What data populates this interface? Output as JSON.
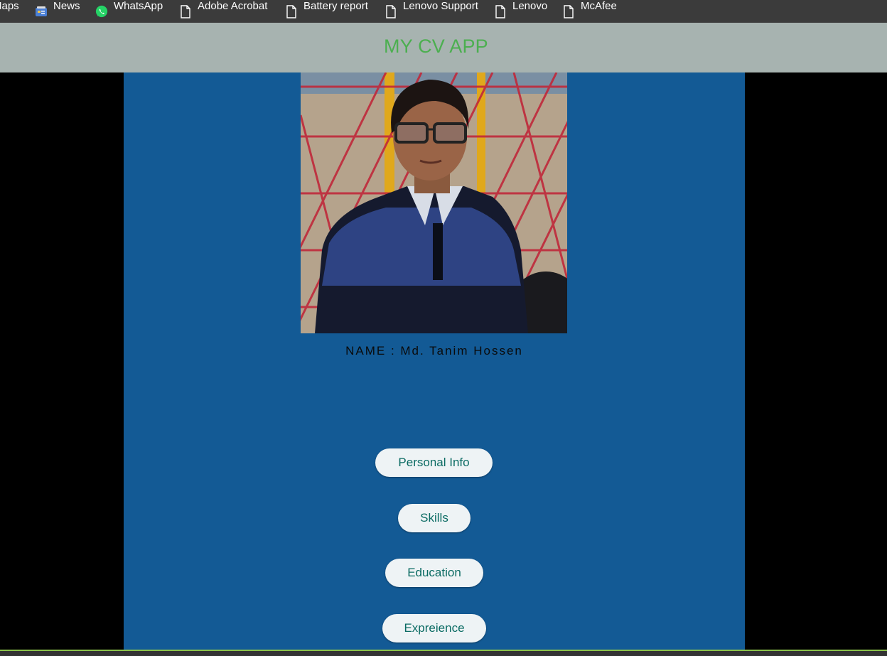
{
  "bookmarks": [
    {
      "label": "Maps",
      "icon": "maps-icon"
    },
    {
      "label": "News",
      "icon": "news-icon"
    },
    {
      "label": "WhatsApp",
      "icon": "whatsapp-icon"
    },
    {
      "label": "Adobe Acrobat",
      "icon": "page-icon"
    },
    {
      "label": "Battery report",
      "icon": "page-icon"
    },
    {
      "label": "Lenovo Support",
      "icon": "page-icon"
    },
    {
      "label": "Lenovo",
      "icon": "page-icon"
    },
    {
      "label": "McAfee",
      "icon": "page-icon"
    }
  ],
  "header": {
    "title": "MY CV APP"
  },
  "profile": {
    "name_text": "NAME : Md. Tanim Hossen"
  },
  "nav": {
    "personal_info": "Personal Info",
    "skills": "Skills",
    "education": "Education",
    "experience": "Expreience"
  },
  "colors": {
    "header_bg": "#a7b3b0",
    "title_green": "#4caf50",
    "panel_blue": "#135a95",
    "button_bg": "#eef3f5",
    "button_text": "#0b6b63"
  }
}
